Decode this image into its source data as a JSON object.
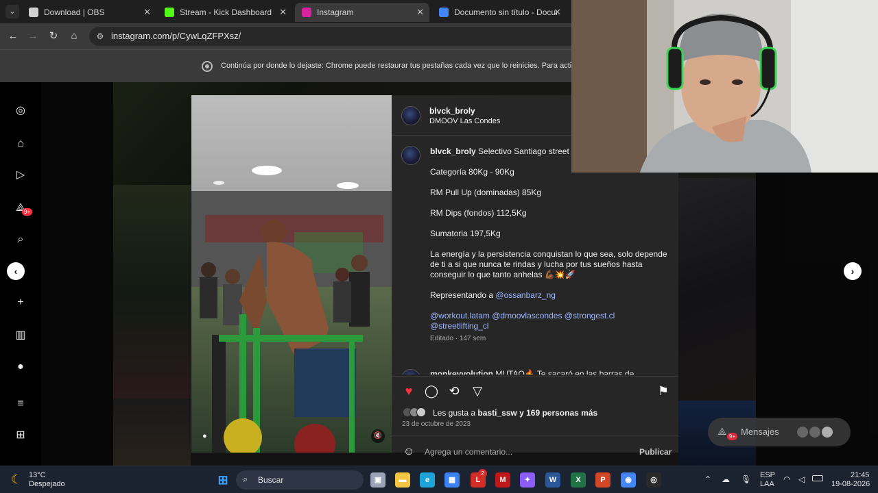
{
  "browser": {
    "tabs": [
      {
        "label": "Download | OBS",
        "favicon_color": "#d0d0d0",
        "active": false
      },
      {
        "label": "Stream - Kick Dashboard",
        "favicon_color": "#53fc18",
        "active": false
      },
      {
        "label": "Instagram",
        "favicon_color": "#d6249f",
        "active": true
      },
      {
        "label": "Documento sin título - Docume",
        "favicon_color": "#4285f4",
        "active": false
      }
    ],
    "url": "instagram.com/p/CywLqZFPXsz/",
    "infobar_message": "Continúa por donde lo dejaste: Chrome puede restaurar tus pestañas cada vez que lo reinicies. Para activar"
  },
  "sidebar": {
    "icons": [
      "instagram-icon",
      "home-icon",
      "reels-icon",
      "messages-icon",
      "search-icon",
      "create-icon",
      "dashboard-icon",
      "profile-icon",
      "menu-icon",
      "more-icon"
    ],
    "messages_badge": "9+"
  },
  "post": {
    "author": "blvck_broly",
    "location": "DMOOV Las Condes",
    "caption_intro": "Selectivo Santiago street lift",
    "caption": [
      "Categoría 80Kg - 90Kg",
      "RM Pull Up (dominadas) 85Kg",
      "RM Dips (fondos) 112,5Kg",
      "Sumatoria 197,5Kg"
    ],
    "motivation": [
      "La energía y la persistencia conquistan lo que sea, solo depende",
      "de ti a si que nunca te rindas y lucha por tus sueños hasta",
      "conseguir lo que tanto anhelas 💪🏾💥🚀"
    ],
    "represent_prefix": "Representando a ",
    "represent_handle": "@ossanbarz_ng",
    "hashtags_line1": "@workout.latam @dmoovlascondes @strongest.cl",
    "hashtags_line2": "@streetlifting_cl",
    "edited": "Editado · 147 sem",
    "next_comment_user": "monkeyvolution",
    "next_comment_text": "MUTAO🔥 Te sacaró en las barras de",
    "likes_prefix": "Les gusta a ",
    "likes_user": "basti_ssw",
    "likes_suffix": " y 169 personas más",
    "date": "23 de octubre de 2023",
    "comment_placeholder": "Agrega un comentario...",
    "publish_label": "Publicar"
  },
  "messages_pill": {
    "label": "Mensajes",
    "badge": "9+"
  },
  "taskbar": {
    "weather_temp": "13°C",
    "weather_desc": "Despejado",
    "search_label": "Buscar",
    "lang_line1": "ESP",
    "lang_line2": "LAA",
    "time": "21:45",
    "date": "19-08-2026",
    "notification_badge": "2",
    "app_icons": [
      {
        "name": "windows-start-icon",
        "color": "#3aa0ff",
        "glyph": "⊞"
      },
      {
        "name": "task-view-icon",
        "color": "#9aa3b5",
        "glyph": "▣"
      },
      {
        "name": "file-explorer-icon",
        "color": "#f4c542",
        "glyph": "▬"
      },
      {
        "name": "edge-icon",
        "color": "#1ea3d8",
        "glyph": "e"
      },
      {
        "name": "store-icon",
        "color": "#3b82f6",
        "glyph": "▦"
      },
      {
        "name": "lastpass-icon",
        "color": "#d32d27",
        "glyph": "L"
      },
      {
        "name": "mcafee-icon",
        "color": "#c01818",
        "glyph": "M"
      },
      {
        "name": "copilot-icon",
        "color": "#8b5cf6",
        "glyph": "✦"
      },
      {
        "name": "word-icon",
        "color": "#2b579a",
        "glyph": "W"
      },
      {
        "name": "excel-icon",
        "color": "#217346",
        "glyph": "X"
      },
      {
        "name": "powerpoint-icon",
        "color": "#d24726",
        "glyph": "P"
      },
      {
        "name": "chrome-icon",
        "color": "#4285f4",
        "glyph": "◉"
      },
      {
        "name": "obs-icon",
        "color": "#2a2a2a",
        "glyph": "◎"
      }
    ]
  }
}
